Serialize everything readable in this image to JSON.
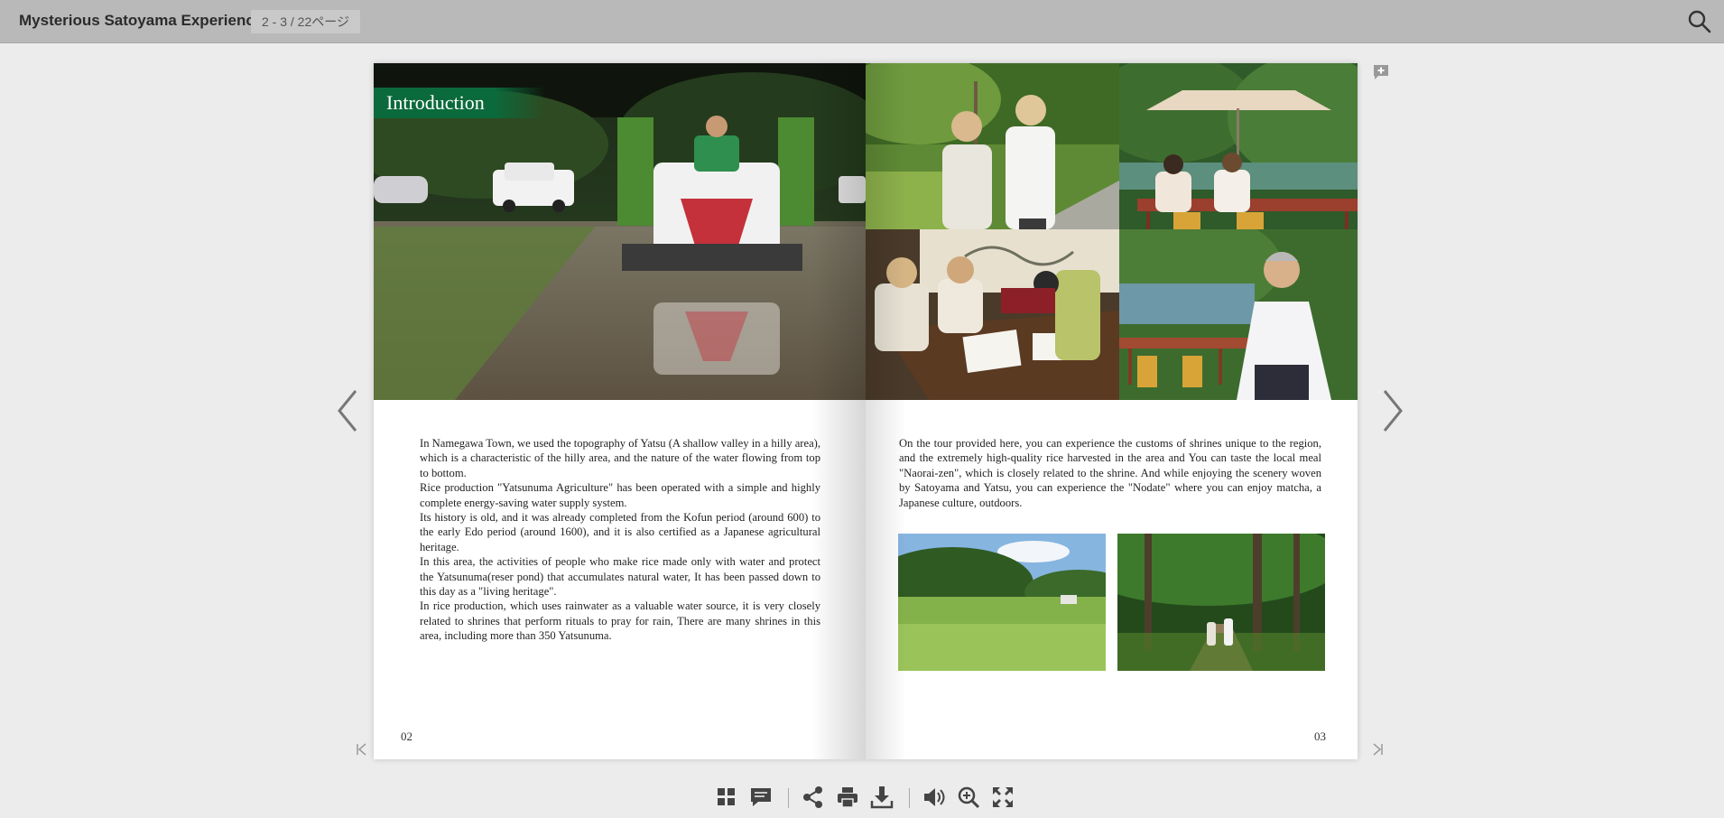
{
  "header": {
    "title": "Mysterious Satoyama Experience",
    "page_indicator": "2 - 3 / 22ページ"
  },
  "book": {
    "left_page": {
      "section_label": "Introduction",
      "paragraphs": [
        "In Namegawa Town, we used the topography of Yatsu (A shallow valley in a hilly area), which is a characteristic of the hilly area, and the nature of the water flowing from top to bottom.",
        "Rice production \"Yatsunuma Agriculture\" has been operated with a simple and highly complete energy-saving water supply system.",
        "Its history is old, and it was already completed from the Kofun period (around 600) to the early Edo period (around 1600), and it is also certified as a Japanese agricultural heritage.",
        "In this area, the activities of people who make rice made only with water and protect the Yatsunuma(reser pond) that accumulates natural water, It has been passed down to this day as a \"living heritage\".",
        "In rice production, which uses rainwater as a valuable water source, it is very closely related to shrines that perform rituals to pray for rain, There are many shrines in this area, including more than 350 Yatsunuma."
      ],
      "page_number": "02"
    },
    "right_page": {
      "paragraph": "On the tour provided here, you can experience the customs of shrines unique to the region, and the extremely high-quality rice harvested in the area and You can taste the local meal \"Naorai-zen\", which is closely related to the shrine. And while enjoying the scenery woven by Satoyama and Yatsu, you can experience the \"Nodate\" where you can enjoy matcha, a Japanese culture, outdoors.",
      "page_number": "03"
    }
  },
  "toolbar": {
    "icons": [
      "thumbnails-icon",
      "comment-icon",
      "share-icon",
      "print-icon",
      "download-icon",
      "sound-icon",
      "zoom-in-icon",
      "fullscreen-icon"
    ]
  },
  "colors": {
    "topbar": "#b9b9b9",
    "background": "#ececec",
    "intro_green": "#0b6a3b",
    "icon": "#444444"
  }
}
